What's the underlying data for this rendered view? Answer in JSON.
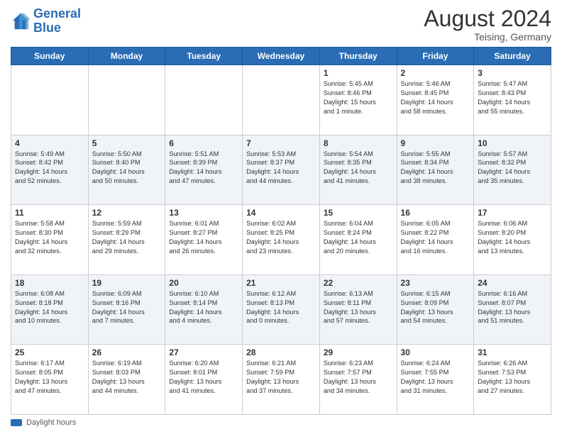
{
  "header": {
    "logo_line1": "General",
    "logo_line2": "Blue",
    "month": "August 2024",
    "location": "Teising, Germany"
  },
  "days_of_week": [
    "Sunday",
    "Monday",
    "Tuesday",
    "Wednesday",
    "Thursday",
    "Friday",
    "Saturday"
  ],
  "footer_legend": "Daylight hours",
  "weeks": [
    [
      {
        "day": "",
        "info": ""
      },
      {
        "day": "",
        "info": ""
      },
      {
        "day": "",
        "info": ""
      },
      {
        "day": "",
        "info": ""
      },
      {
        "day": "1",
        "info": "Sunrise: 5:45 AM\nSunset: 8:46 PM\nDaylight: 15 hours\nand 1 minute."
      },
      {
        "day": "2",
        "info": "Sunrise: 5:46 AM\nSunset: 8:45 PM\nDaylight: 14 hours\nand 58 minutes."
      },
      {
        "day": "3",
        "info": "Sunrise: 5:47 AM\nSunset: 8:43 PM\nDaylight: 14 hours\nand 55 minutes."
      }
    ],
    [
      {
        "day": "4",
        "info": "Sunrise: 5:49 AM\nSunset: 8:42 PM\nDaylight: 14 hours\nand 52 minutes."
      },
      {
        "day": "5",
        "info": "Sunrise: 5:50 AM\nSunset: 8:40 PM\nDaylight: 14 hours\nand 50 minutes."
      },
      {
        "day": "6",
        "info": "Sunrise: 5:51 AM\nSunset: 8:39 PM\nDaylight: 14 hours\nand 47 minutes."
      },
      {
        "day": "7",
        "info": "Sunrise: 5:53 AM\nSunset: 8:37 PM\nDaylight: 14 hours\nand 44 minutes."
      },
      {
        "day": "8",
        "info": "Sunrise: 5:54 AM\nSunset: 8:35 PM\nDaylight: 14 hours\nand 41 minutes."
      },
      {
        "day": "9",
        "info": "Sunrise: 5:55 AM\nSunset: 8:34 PM\nDaylight: 14 hours\nand 38 minutes."
      },
      {
        "day": "10",
        "info": "Sunrise: 5:57 AM\nSunset: 8:32 PM\nDaylight: 14 hours\nand 35 minutes."
      }
    ],
    [
      {
        "day": "11",
        "info": "Sunrise: 5:58 AM\nSunset: 8:30 PM\nDaylight: 14 hours\nand 32 minutes."
      },
      {
        "day": "12",
        "info": "Sunrise: 5:59 AM\nSunset: 8:29 PM\nDaylight: 14 hours\nand 29 minutes."
      },
      {
        "day": "13",
        "info": "Sunrise: 6:01 AM\nSunset: 8:27 PM\nDaylight: 14 hours\nand 26 minutes."
      },
      {
        "day": "14",
        "info": "Sunrise: 6:02 AM\nSunset: 8:25 PM\nDaylight: 14 hours\nand 23 minutes."
      },
      {
        "day": "15",
        "info": "Sunrise: 6:04 AM\nSunset: 8:24 PM\nDaylight: 14 hours\nand 20 minutes."
      },
      {
        "day": "16",
        "info": "Sunrise: 6:05 AM\nSunset: 8:22 PM\nDaylight: 14 hours\nand 16 minutes."
      },
      {
        "day": "17",
        "info": "Sunrise: 6:06 AM\nSunset: 8:20 PM\nDaylight: 14 hours\nand 13 minutes."
      }
    ],
    [
      {
        "day": "18",
        "info": "Sunrise: 6:08 AM\nSunset: 8:18 PM\nDaylight: 14 hours\nand 10 minutes."
      },
      {
        "day": "19",
        "info": "Sunrise: 6:09 AM\nSunset: 8:16 PM\nDaylight: 14 hours\nand 7 minutes."
      },
      {
        "day": "20",
        "info": "Sunrise: 6:10 AM\nSunset: 8:14 PM\nDaylight: 14 hours\nand 4 minutes."
      },
      {
        "day": "21",
        "info": "Sunrise: 6:12 AM\nSunset: 8:13 PM\nDaylight: 14 hours\nand 0 minutes."
      },
      {
        "day": "22",
        "info": "Sunrise: 6:13 AM\nSunset: 8:11 PM\nDaylight: 13 hours\nand 57 minutes."
      },
      {
        "day": "23",
        "info": "Sunrise: 6:15 AM\nSunset: 8:09 PM\nDaylight: 13 hours\nand 54 minutes."
      },
      {
        "day": "24",
        "info": "Sunrise: 6:16 AM\nSunset: 8:07 PM\nDaylight: 13 hours\nand 51 minutes."
      }
    ],
    [
      {
        "day": "25",
        "info": "Sunrise: 6:17 AM\nSunset: 8:05 PM\nDaylight: 13 hours\nand 47 minutes."
      },
      {
        "day": "26",
        "info": "Sunrise: 6:19 AM\nSunset: 8:03 PM\nDaylight: 13 hours\nand 44 minutes."
      },
      {
        "day": "27",
        "info": "Sunrise: 6:20 AM\nSunset: 8:01 PM\nDaylight: 13 hours\nand 41 minutes."
      },
      {
        "day": "28",
        "info": "Sunrise: 6:21 AM\nSunset: 7:59 PM\nDaylight: 13 hours\nand 37 minutes."
      },
      {
        "day": "29",
        "info": "Sunrise: 6:23 AM\nSunset: 7:57 PM\nDaylight: 13 hours\nand 34 minutes."
      },
      {
        "day": "30",
        "info": "Sunrise: 6:24 AM\nSunset: 7:55 PM\nDaylight: 13 hours\nand 31 minutes."
      },
      {
        "day": "31",
        "info": "Sunrise: 6:26 AM\nSunset: 7:53 PM\nDaylight: 13 hours\nand 27 minutes."
      }
    ]
  ]
}
